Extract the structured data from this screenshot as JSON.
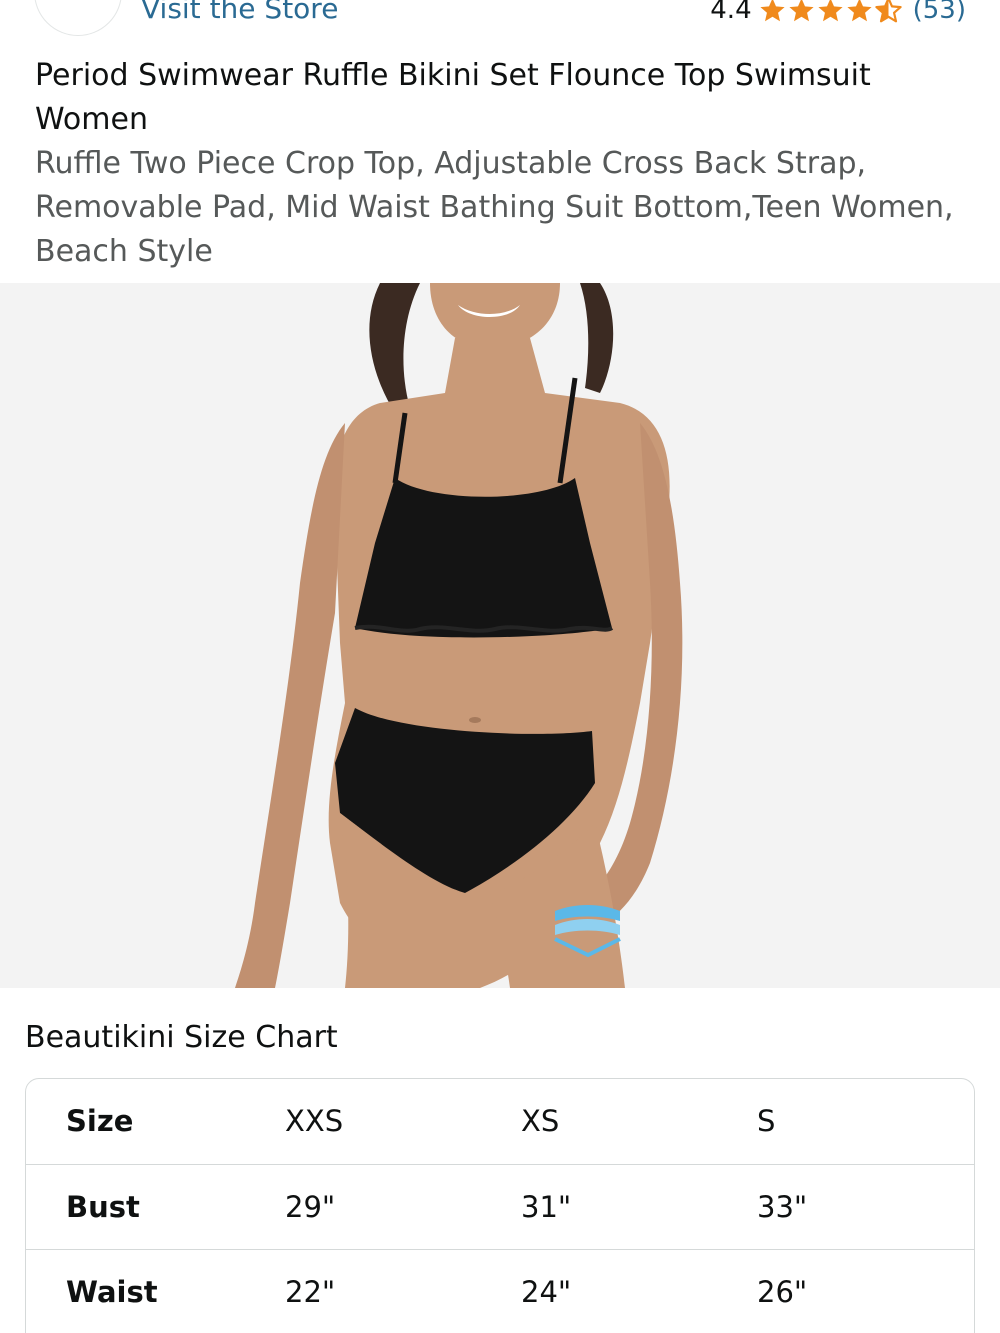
{
  "store": {
    "link_label": "Visit the Store"
  },
  "rating": {
    "value": "4.4",
    "stars": 4.4,
    "count": "(53)",
    "star_color": "#f08a1c"
  },
  "product": {
    "title": "Period Swimwear Ruffle Bikini Set Flounce Top Swimsuit Women",
    "subtitle": "Ruffle Two Piece Crop Top, Adjustable Cross Back Strap, Removable Pad, Mid Waist Bathing Suit Bottom,Teen Women, Beach Style"
  },
  "size_chart": {
    "heading": "Beautikini Size Chart",
    "rows": [
      {
        "label": "Size",
        "values": [
          "XXS",
          "XS",
          "S"
        ]
      },
      {
        "label": "Bust",
        "values": [
          "29\"",
          "31\"",
          "33\""
        ]
      },
      {
        "label": "Waist",
        "values": [
          "22\"",
          "24\"",
          "26\""
        ]
      }
    ]
  },
  "colors": {
    "link": "#2a6a93",
    "text": "#0f1111",
    "secondary_text": "#565959",
    "image_background": "#f3f3f3",
    "swimsuit": "#141414",
    "skin": "#c99a78",
    "pad_icon": "#5bb8e8"
  }
}
